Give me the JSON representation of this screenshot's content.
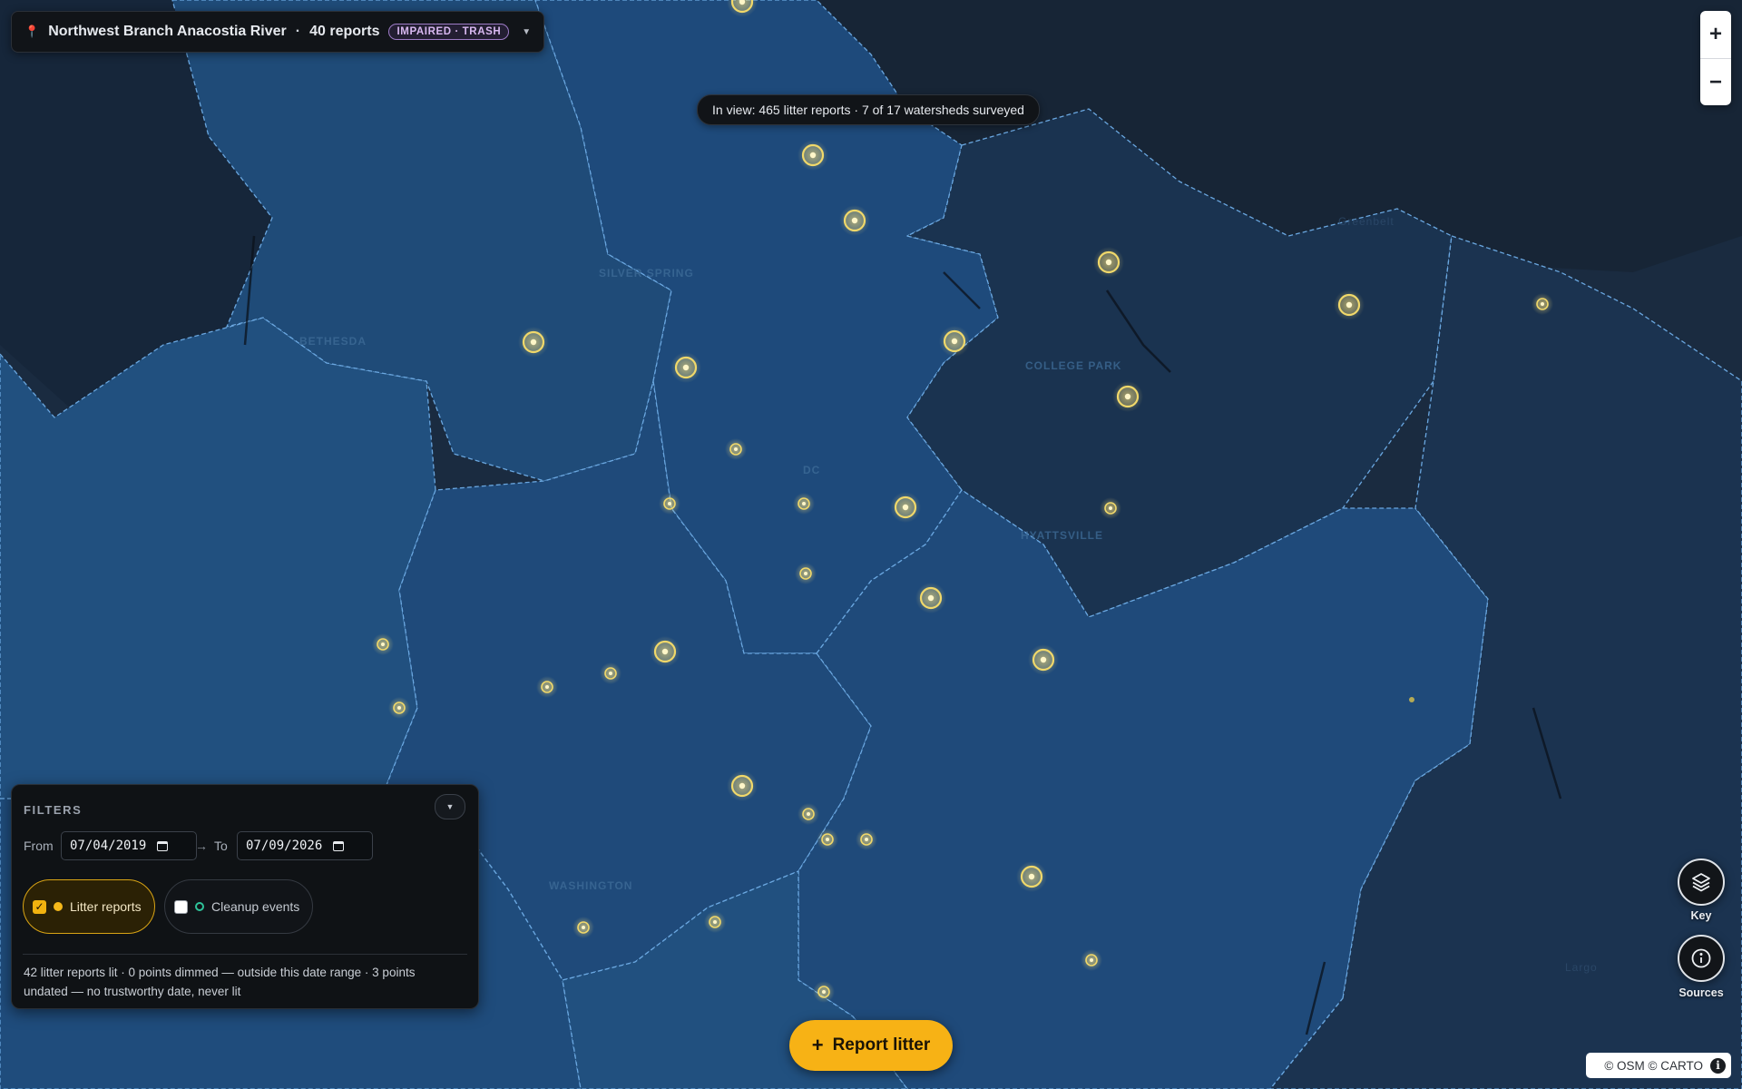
{
  "watershed": {
    "name": "Northwest Branch Anacostia River",
    "count_label": "40 reports",
    "status_badge": "IMPAIRED · TRASH"
  },
  "in_view": "In view: 465 litter reports · 7 of 17 watersheds surveyed",
  "zoom": {
    "in": "+",
    "out": "−"
  },
  "right_buttons": {
    "key_label": "Key",
    "sources_label": "Sources"
  },
  "filters": {
    "title": "FILTERS",
    "from_label": "From",
    "from_value": "07/04/2019",
    "to_label": "To",
    "to_value": "07/09/2026",
    "arrow": "→",
    "layers": [
      {
        "label": "Litter reports",
        "checked": true
      },
      {
        "label": "Cleanup events",
        "checked": false
      }
    ],
    "summary": "42 litter reports lit · 0 points dimmed — outside this date range · 3 points undated — no trustworthy date, never lit"
  },
  "report_button": "Report litter",
  "attribution": "© OSM © CARTO",
  "place_labels": [
    "SILVER SPRING",
    "BETHESDA",
    "COLLEGE PARK",
    "Greenbelt",
    "HYATTSVILLE",
    "WASHINGTON",
    "DC",
    "Largo"
  ],
  "colors": {
    "map_background": "#1a2b40",
    "watershed_fill": "#1f4a7a",
    "accent_yellow": "#f5b81a",
    "impaired_badge": "#9d7bc6",
    "cleanup_green": "#2fc39a"
  }
}
